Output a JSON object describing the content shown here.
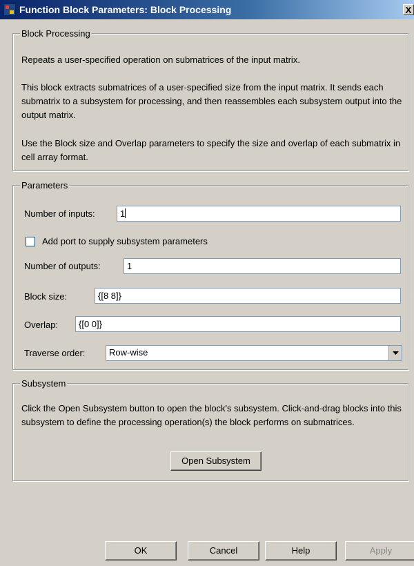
{
  "window": {
    "title": "Function Block Parameters: Block Processing",
    "close_glyph": "X"
  },
  "block": {
    "legend": "Block Processing",
    "paragraph1": "Repeats a user-specified operation on submatrices of the input matrix.",
    "paragraph2": "This block extracts submatrices of a user-specified size from the input matrix. It sends each submatrix to a subsystem for processing, and then reassembles each subsystem output into the output matrix.",
    "paragraph3": "Use the Block size and Overlap parameters to specify the size and overlap of each submatrix in cell array format."
  },
  "parameters": {
    "legend": "Parameters",
    "num_inputs_label": "Number of inputs:",
    "num_inputs_value": "1",
    "add_port_label": "Add port to supply subsystem parameters",
    "add_port_checked": false,
    "num_outputs_label": "Number of outputs:",
    "num_outputs_value": "1",
    "block_size_label": "Block size:",
    "block_size_value": "{[8 8]}",
    "overlap_label": "Overlap:",
    "overlap_value": "{[0 0]}",
    "traverse_label": "Traverse order:",
    "traverse_value": "Row-wise"
  },
  "subsystem": {
    "legend": "Subsystem",
    "description": "Click the Open Subsystem button to open the block's subsystem. Click-and-drag blocks into this subsystem to define the processing operation(s) the block performs on submatrices.",
    "open_button": "Open Subsystem"
  },
  "buttons": {
    "ok": "OK",
    "cancel": "Cancel",
    "help": "Help",
    "apply": "Apply",
    "apply_enabled": false
  },
  "colors": {
    "title_bar_start": "#0a246a",
    "dialog_background": "#d4d0c8"
  }
}
